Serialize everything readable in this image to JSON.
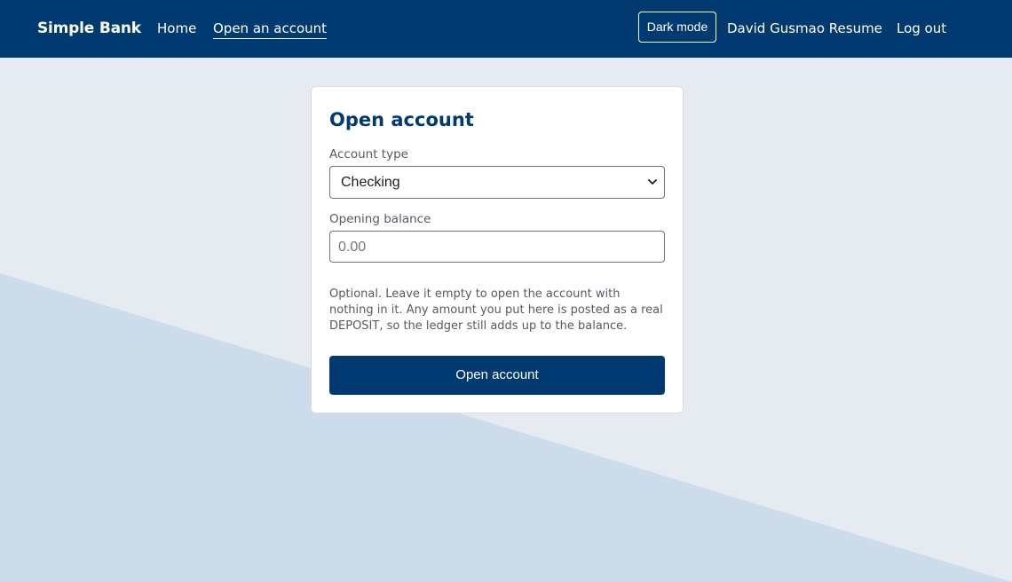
{
  "navbar": {
    "brand": "Simple Bank",
    "links": {
      "home": "Home",
      "open_account": "Open an account",
      "resume": "David Gusmao Resume",
      "logout": "Log out"
    },
    "dark_mode_label": "Dark mode"
  },
  "form": {
    "title": "Open account",
    "account_type_label": "Account type",
    "account_type_value": "Checking",
    "opening_balance_label": "Opening balance",
    "opening_balance_placeholder": "0.00",
    "help_text": "Optional. Leave it empty to open the account with nothing in it. Any amount you put here is posted as a real DEPOSIT, so the ledger still adds up to the balance.",
    "submit_label": "Open account"
  },
  "colors": {
    "primary": "#003a70",
    "page_background": "#e6eaf1",
    "background_accent": "#cddcea"
  }
}
